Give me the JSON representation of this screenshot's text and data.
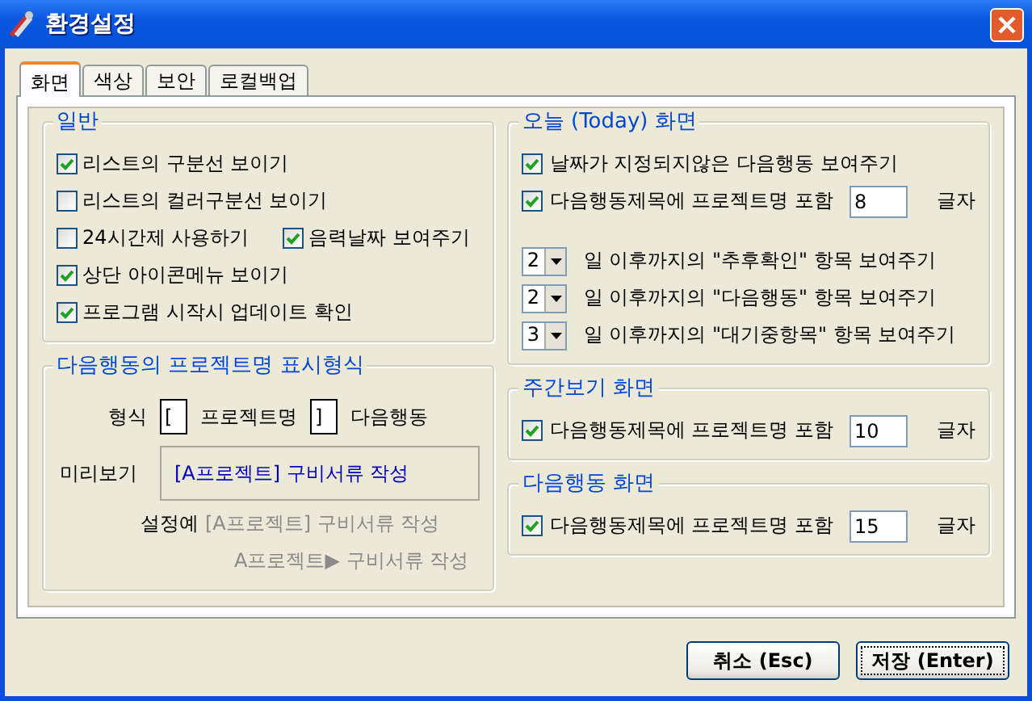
{
  "window": {
    "title": "환경설정"
  },
  "tabs": [
    {
      "label": "화면",
      "selected": true
    },
    {
      "label": "색상",
      "selected": false
    },
    {
      "label": "보안",
      "selected": false
    },
    {
      "label": "로컬백업",
      "selected": false
    }
  ],
  "general": {
    "title": "일반",
    "rows": [
      [
        {
          "label": "리스트의 구분선 보이기",
          "checked": true
        }
      ],
      [
        {
          "label": "리스트의 컬러구분선 보이기",
          "checked": false
        }
      ],
      [
        {
          "label": "24시간제 사용하기",
          "checked": false
        },
        {
          "label": "음력날짜 보여주기",
          "checked": true
        }
      ],
      [
        {
          "label": "상단 아이콘메뉴 보이기",
          "checked": true
        }
      ],
      [
        {
          "label": "프로그램 시작시 업데이트 확인",
          "checked": true
        }
      ]
    ]
  },
  "project_format": {
    "title": "다음행동의 프로젝트명 표시형식",
    "format_label": "형식",
    "prefix": "[",
    "project_label": "프로젝트명",
    "suffix": "]",
    "action_label": "다음행동",
    "preview_label": "미리보기",
    "preview": "[A프로젝트] 구비서류 작성",
    "example_label": "설정예",
    "examples": [
      "[A프로젝트] 구비서류 작성",
      "A프로젝트▶ 구비서류 작성"
    ]
  },
  "today": {
    "title": "오늘 (Today) 화면",
    "options": [
      {
        "label": "날짜가 지정되지않은 다음행동 보여주기",
        "checked": true
      },
      {
        "label": "다음행동제목에 프로젝트명 포함",
        "checked": true,
        "value": "8",
        "unit": "글자"
      }
    ],
    "day_rows": [
      {
        "value": "2",
        "label": "일 이후까지의 \"추후확인\" 항목 보여주기"
      },
      {
        "value": "2",
        "label": "일 이후까지의 \"다음행동\" 항목 보여주기"
      },
      {
        "value": "3",
        "label": "일 이후까지의 \"대기중항목\" 항목 보여주기"
      }
    ]
  },
  "weekly": {
    "title": "주간보기 화면",
    "options": [
      {
        "label": "다음행동제목에 프로젝트명 포함",
        "checked": true,
        "value": "10",
        "unit": "글자"
      }
    ]
  },
  "next_action": {
    "title": "다음행동 화면",
    "options": [
      {
        "label": "다음행동제목에 프로젝트명 포함",
        "checked": true,
        "value": "15",
        "unit": "글자"
      }
    ]
  },
  "buttons": [
    {
      "label": "취소 (Esc)",
      "default": false
    },
    {
      "label": "저장 (Enter)",
      "default": true
    }
  ]
}
